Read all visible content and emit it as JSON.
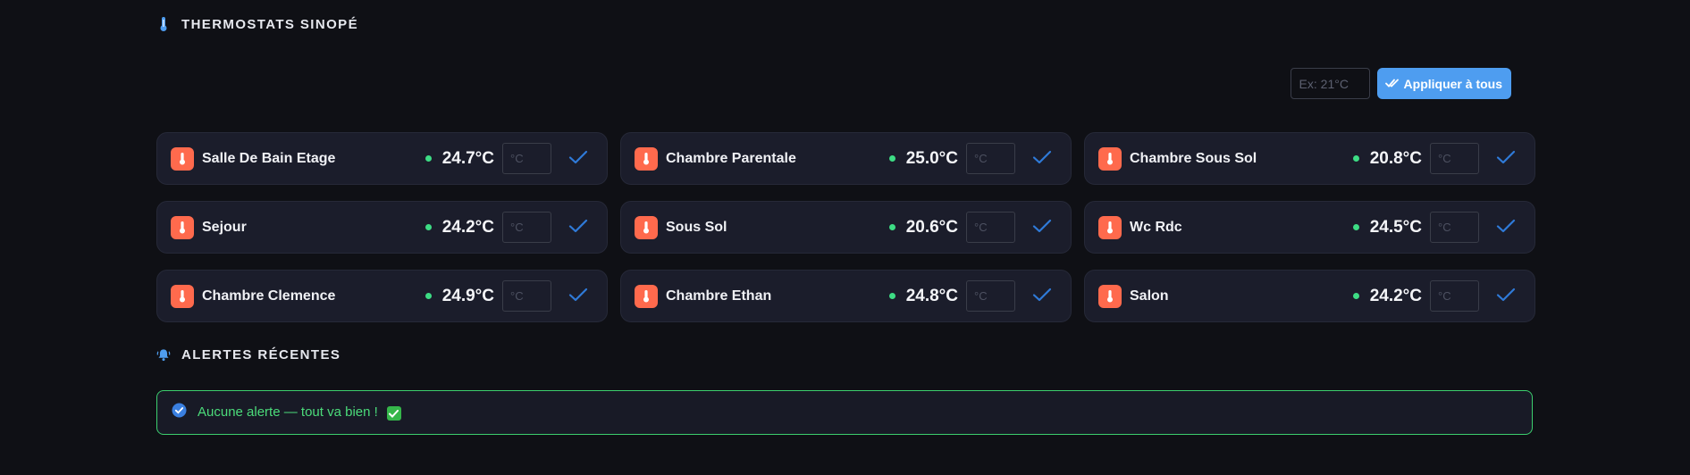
{
  "thermostats_section": {
    "title": "THERMOSTATS SINOPÉ",
    "icon": "thermometer-icon",
    "global_input_placeholder": "Ex: 21°C",
    "apply_all_label": "Appliquer à tous",
    "set_placeholder": "°C",
    "items": [
      {
        "name": "Salle De Bain Etage",
        "temperature": "24.7°C"
      },
      {
        "name": "Chambre Parentale",
        "temperature": "25.0°C"
      },
      {
        "name": "Chambre Sous Sol",
        "temperature": "20.8°C"
      },
      {
        "name": "Sejour",
        "temperature": "24.2°C"
      },
      {
        "name": "Sous Sol",
        "temperature": "20.6°C"
      },
      {
        "name": "Wc Rdc",
        "temperature": "24.5°C"
      },
      {
        "name": "Chambre Clemence",
        "temperature": "24.9°C"
      },
      {
        "name": "Chambre Ethan",
        "temperature": "24.8°C"
      },
      {
        "name": "Salon",
        "temperature": "24.2°C"
      }
    ]
  },
  "alerts_section": {
    "title": "ALERTES RÉCENTES",
    "icon": "bell-icon",
    "message": "Aucune alerte — tout va bien !",
    "message_icon": "check-circle-icon",
    "trailing_emoji": "check-mark-button-emoji"
  },
  "colors": {
    "background": "#0f1015",
    "card": "#1b1d2b",
    "accent_blue": "#4e9df0",
    "badge_orange": "#ff6a4d",
    "status_green": "#3ddc84",
    "alert_green": "#3ccf6e"
  }
}
